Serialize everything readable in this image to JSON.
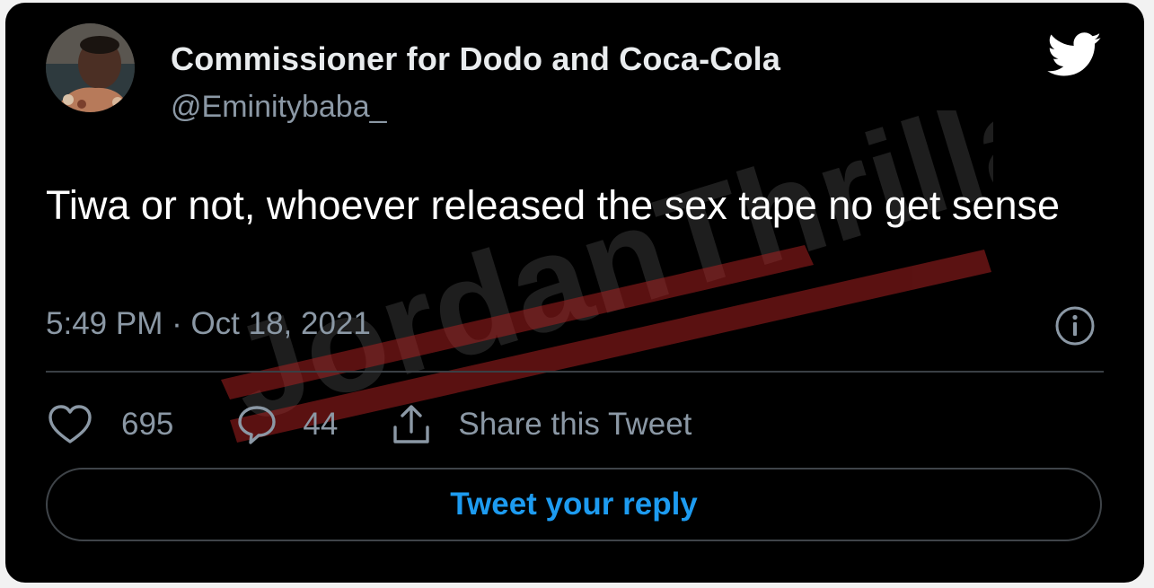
{
  "tweet": {
    "display_name": "Commissioner for Dodo and Coca-Cola",
    "handle": "@Eminitybaba_",
    "text": "Tiwa or not, whoever released the sex tape no get sense",
    "timestamp": "5:49 PM · Oct 18, 2021"
  },
  "stats": {
    "likes": "695",
    "replies": "44",
    "share_label": "Share this Tweet"
  },
  "reply": {
    "label": "Tweet your reply"
  },
  "watermark": {
    "text": "JordanThrilla."
  },
  "icons": {
    "brand": "twitter-bird-icon",
    "info": "info-icon",
    "like": "heart-icon",
    "reply": "reply-bubble-icon",
    "share": "share-upload-icon"
  },
  "colors": {
    "background": "#000000",
    "primary_text": "#ffffff",
    "secondary_text": "#8b98a5",
    "accent": "#1d9bf0",
    "watermark": "#c62828"
  }
}
